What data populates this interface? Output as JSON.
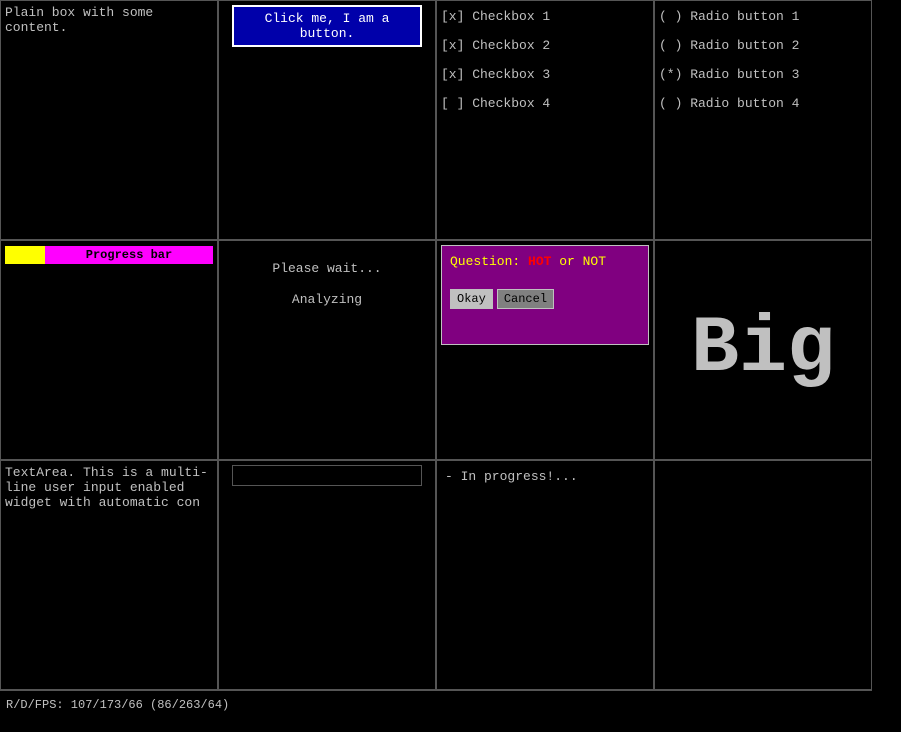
{
  "plain_box": {
    "text": "Plain box with some content."
  },
  "button": {
    "label": "Click me, I am a button."
  },
  "checkboxes": {
    "items": [
      {
        "label": "[x] Checkbox 1",
        "checked": true
      },
      {
        "label": "[x] Checkbox 2",
        "checked": true
      },
      {
        "label": "[x] Checkbox 3",
        "checked": true
      },
      {
        "label": "[ ] Checkbox 4",
        "checked": false
      }
    ]
  },
  "radios": {
    "items": [
      {
        "label": "( ) Radio button 1",
        "selected": false
      },
      {
        "label": "( ) Radio button 2",
        "selected": false
      },
      {
        "label": "(*) Radio button 3",
        "selected": true
      },
      {
        "label": "( ) Radio button 4",
        "selected": false
      }
    ]
  },
  "progress_bar": {
    "label": "Progress bar",
    "yellow_width": 40,
    "filled_percent": 20
  },
  "please_wait": {
    "title": "Please wait...",
    "subtitle": "Analyzing"
  },
  "question": {
    "title_prefix": "Question: ",
    "title_hot": "HOT",
    "title_suffix": " or NOT",
    "okay_label": "Okay",
    "cancel_label": "Cancel"
  },
  "big_display": {
    "text": "Big"
  },
  "textarea": {
    "value": "TextArea. This is a multi-line user input enabled widget with automatic con",
    "placeholder": ""
  },
  "input_field": {
    "value": "",
    "placeholder": ""
  },
  "inprogress": {
    "text": "- In progress!..."
  },
  "status_bar": {
    "text": "R/D/FPS: 107/173/66 (86/263/64)"
  }
}
